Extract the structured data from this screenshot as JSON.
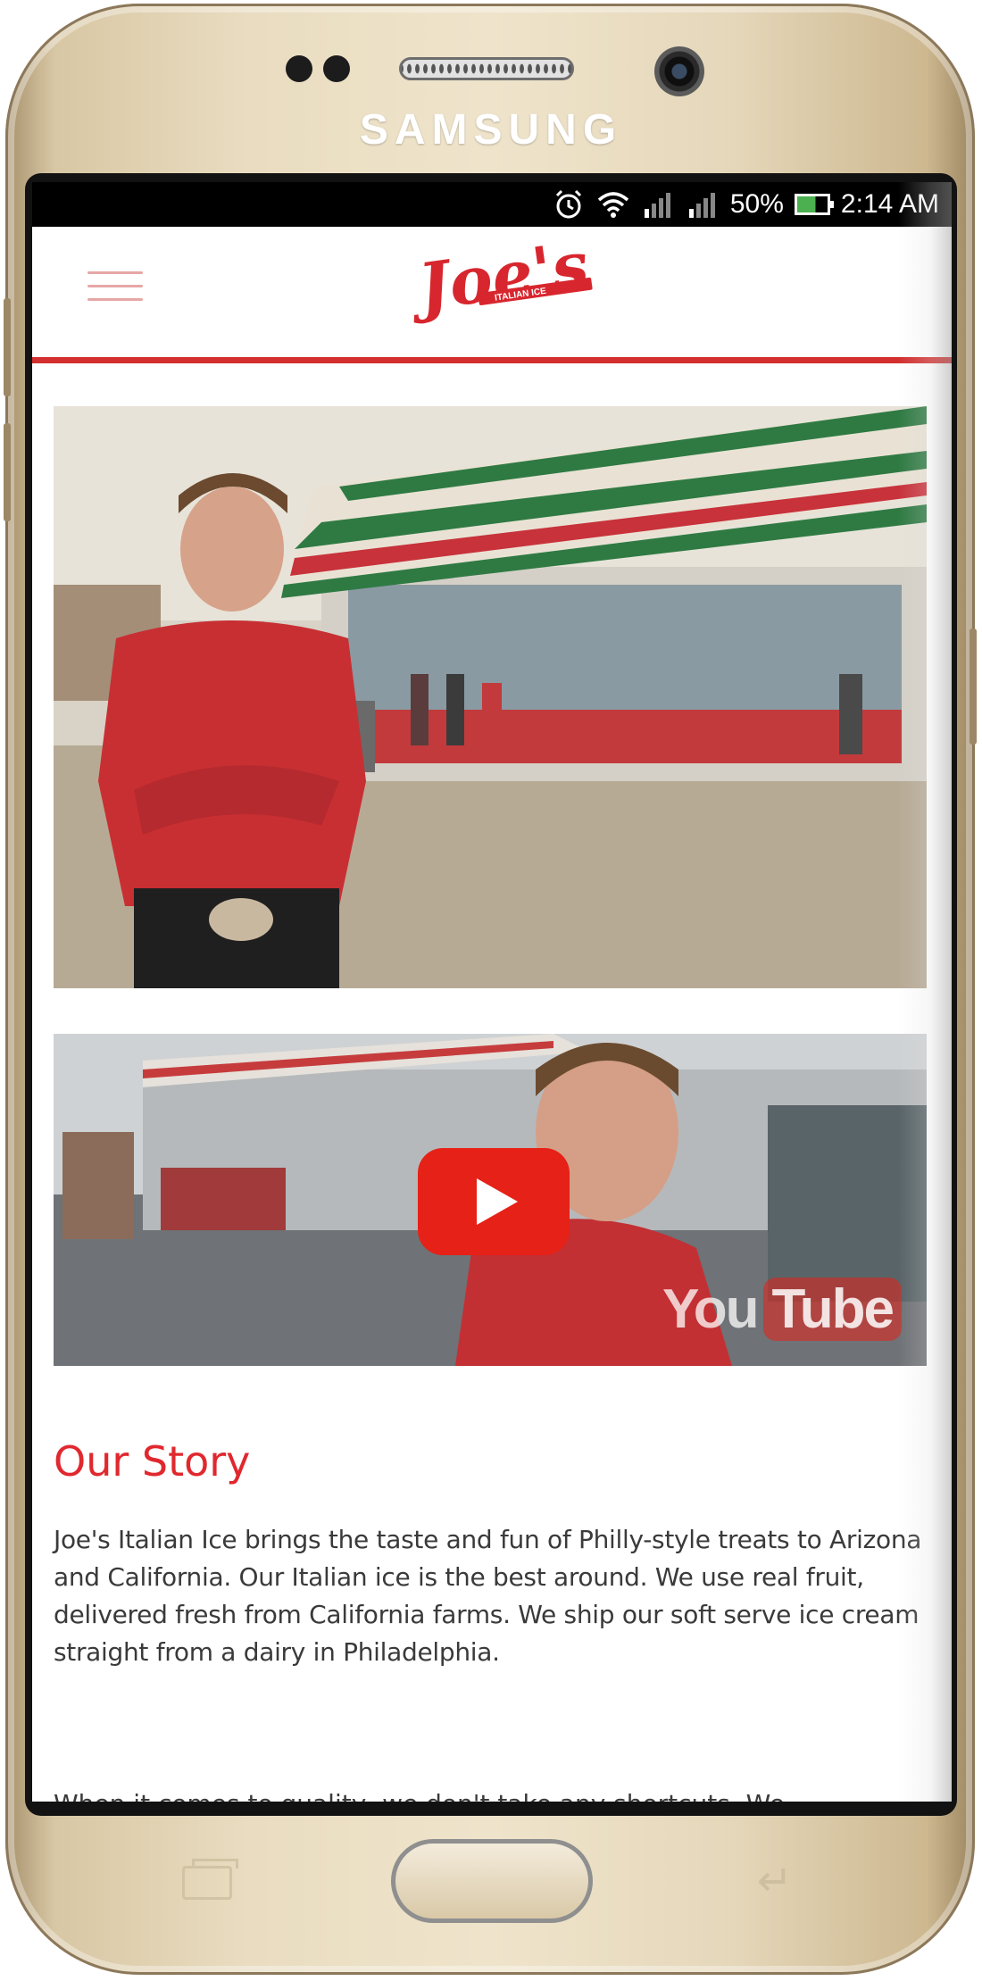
{
  "device": {
    "brand": "SAMSUNG"
  },
  "status_bar": {
    "battery": "50%",
    "time": "2:14 AM",
    "icons": [
      "alarm-icon",
      "wifi-icon",
      "signal-icon",
      "signal-icon",
      "battery-charging-icon"
    ]
  },
  "header": {
    "logo_text": "Joe's",
    "logo_tagline": "ITALIAN ICE",
    "accent_color": "#d32f2f"
  },
  "video": {
    "watermark_you": "You",
    "watermark_tube": "Tube"
  },
  "story": {
    "title": "Our Story",
    "body": "Joe's Italian Ice brings the taste and fun of Philly-style treats to Arizona and California. Our Italian ice is the best around. We use real fruit, delivered fresh from California farms. We ship our soft serve ice cream straight from a dairy in Philadelphia.",
    "next_paragraph_partial": "When it comes to quality, we don't take any shortcuts. We"
  }
}
